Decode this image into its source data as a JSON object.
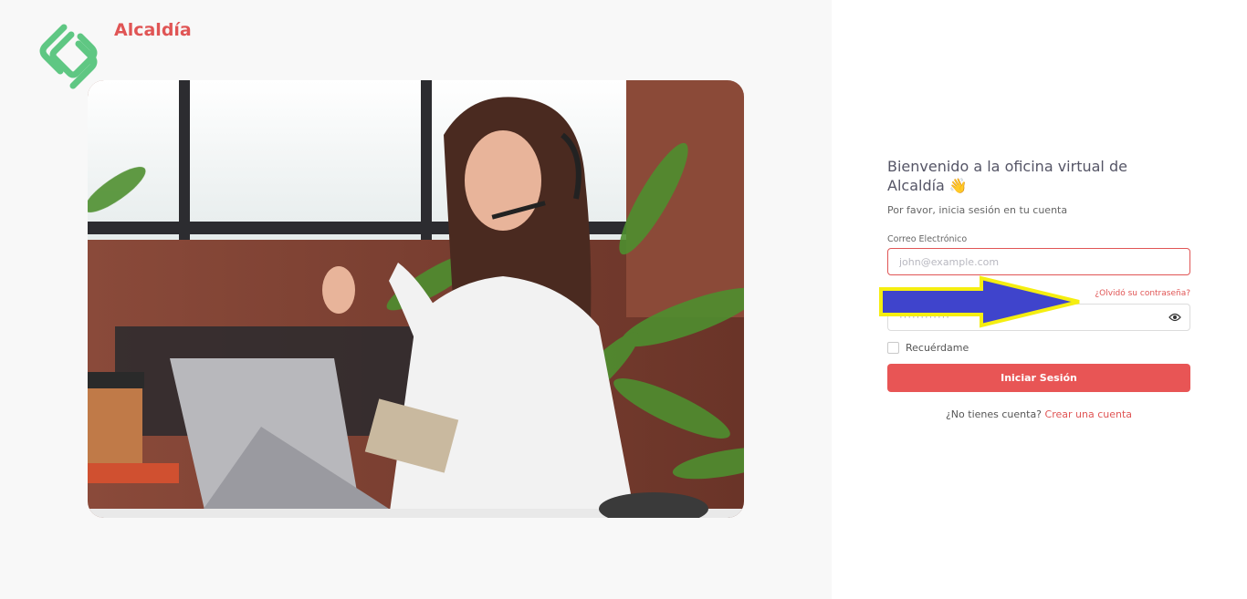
{
  "brand": {
    "name": "Alcaldía",
    "logo_icon": "brand-logo-icon",
    "accent_color": "#e05555"
  },
  "hero": {
    "image_alt": "hero-photo"
  },
  "login": {
    "welcome_line1": "Bienvenido a la oficina virtual de",
    "welcome_line2": "Alcaldía 👋",
    "subtitle": "Por favor, inicia sesión en tu cuenta",
    "email_label": "Correo Electrónico",
    "email_placeholder": "john@example.com",
    "forgot_password": "¿Olvidó su contraseña?",
    "password_placeholder": "············",
    "eye_icon": "eye-icon",
    "remember_label": "Recuérdame",
    "submit_label": "Iniciar Sesión",
    "no_account_text": "¿No tienes cuenta?",
    "create_account_link": "Crear una cuenta"
  },
  "annotation": {
    "arrow_color": "#3f44cc",
    "arrow_outline": "#f5ee10"
  }
}
